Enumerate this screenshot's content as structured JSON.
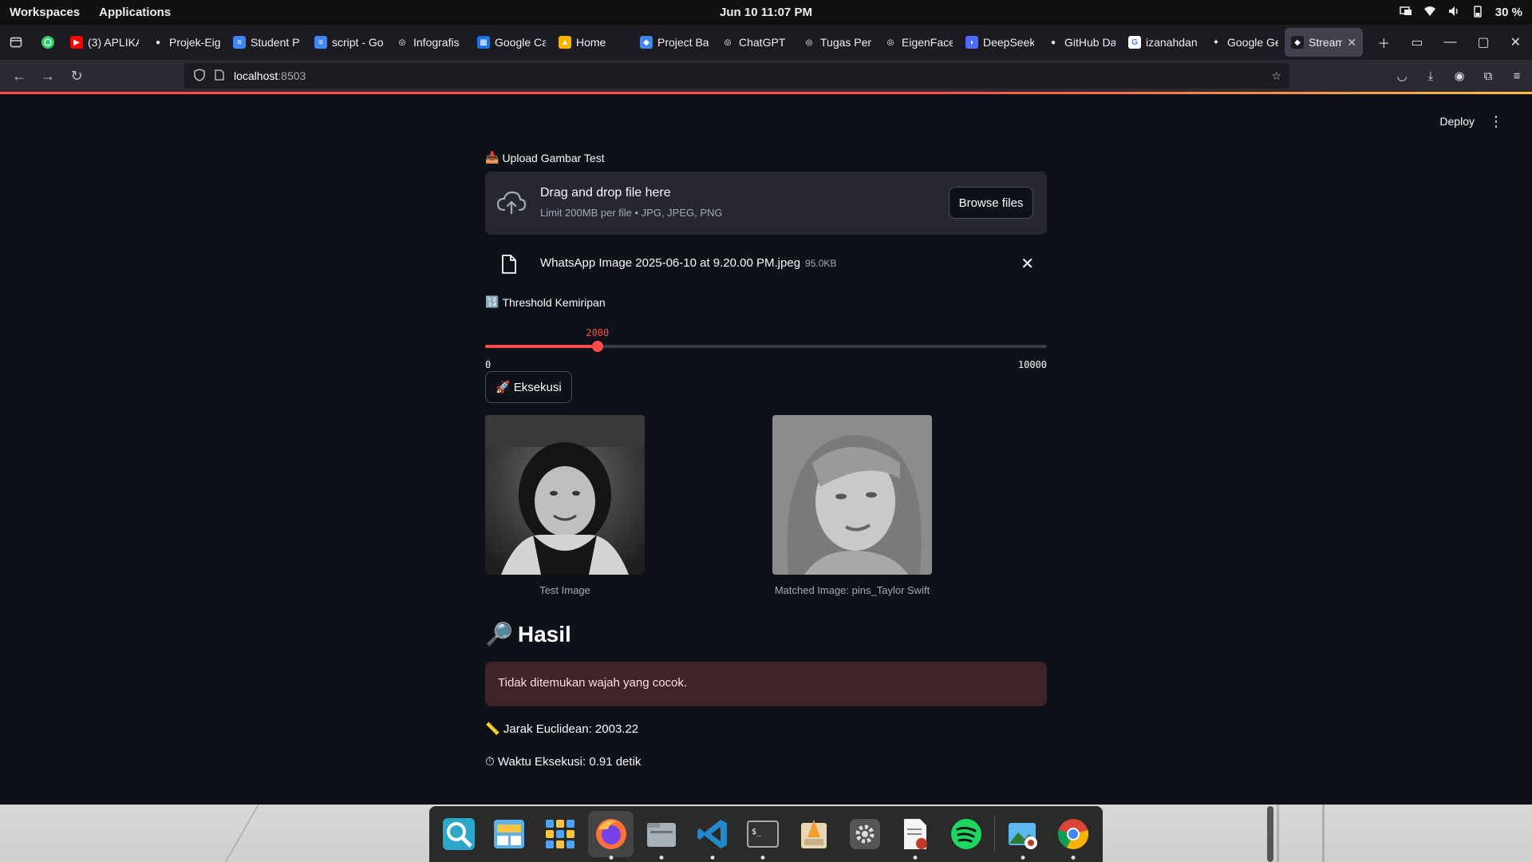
{
  "system": {
    "workspaces": "Workspaces",
    "applications": "Applications",
    "clock": "Jun 10  11:07 PM",
    "battery": "30 %"
  },
  "browser": {
    "tabs": [
      {
        "label": "(3) APLIKA",
        "fav_color": "#ff0000",
        "fav_glyph": "▶",
        "icon": "youtube-icon"
      },
      {
        "label": "Projek-Eig",
        "fav_color": "#1c1b22",
        "fav_glyph": "●",
        "icon": "github-icon"
      },
      {
        "label": "Student P",
        "fav_color": "#4285f4",
        "fav_glyph": "≡",
        "icon": "docs-icon"
      },
      {
        "label": "script - Go",
        "fav_color": "#4285f4",
        "fav_glyph": "≡",
        "icon": "docs-icon"
      },
      {
        "label": "Infografis",
        "fav_color": "#1c1b22",
        "fav_glyph": "◎",
        "icon": "chatgpt-icon"
      },
      {
        "label": "Google Ca",
        "fav_color": "#1a73e8",
        "fav_glyph": "▦",
        "icon": "calendar-icon"
      },
      {
        "label": "Home",
        "fav_color": "#f4b400",
        "fav_glyph": "▲",
        "icon": "home-icon"
      },
      {
        "label": "Project Ba",
        "fav_color": "#4285f4",
        "fav_glyph": "◆",
        "icon": "project-icon"
      },
      {
        "label": "ChatGPT",
        "fav_color": "#1c1b22",
        "fav_glyph": "◎",
        "icon": "chatgpt-icon"
      },
      {
        "label": "Tugas Pen",
        "fav_color": "#1c1b22",
        "fav_glyph": "◎",
        "icon": "chatgpt-icon"
      },
      {
        "label": "EigenFace",
        "fav_color": "#1c1b22",
        "fav_glyph": "◎",
        "icon": "chatgpt-icon"
      },
      {
        "label": "DeepSeek",
        "fav_color": "#4d6bfe",
        "fav_glyph": "◗",
        "icon": "deepseek-icon"
      },
      {
        "label": "GitHub Da",
        "fav_color": "#1c1b22",
        "fav_glyph": "●",
        "icon": "github-icon"
      },
      {
        "label": "izanahdan",
        "fav_color": "#ffffff",
        "fav_glyph": "G",
        "icon": "google-icon"
      },
      {
        "label": "Google Ge",
        "fav_color": "#1c1b22",
        "fav_glyph": "✦",
        "icon": "gemini-icon"
      },
      {
        "label": "Streaml",
        "fav_color": "#1c1b22",
        "fav_glyph": "◆",
        "icon": "streamlit-icon",
        "active": true
      }
    ],
    "url_host": "localhost",
    "url_port": ":8503"
  },
  "app": {
    "deploy": "Deploy",
    "upload_label": "Upload Gambar Test",
    "drop_title": "Drag and drop file here",
    "drop_limit": "Limit 200MB per file • JPG, JPEG, PNG",
    "browse": "Browse files",
    "file_name": "WhatsApp Image 2025-06-10 at 9.20.00 PM.jpeg",
    "file_size": "95.0KB",
    "threshold_label": "Threshold Kemiripan",
    "slider": {
      "value": 2000,
      "min": 0,
      "max": 10000,
      "value_text": "2000",
      "min_text": "0",
      "max_text": "10000"
    },
    "exec_button": "Eksekusi",
    "test_caption": "Test Image",
    "match_caption": "Matched Image: pins_Taylor Swift",
    "hasil_title": "Hasil",
    "alert": "Tidak ditemukan wajah yang cocok.",
    "distance": "Jarak Euclidean: 2003.22",
    "time": "Waktu Eksekusi: 0.91 detik"
  },
  "colors": {
    "accent": "#ff4b4b",
    "background": "#0e1117",
    "secondary_bg": "#262730",
    "error_bg": "#3e2327"
  }
}
